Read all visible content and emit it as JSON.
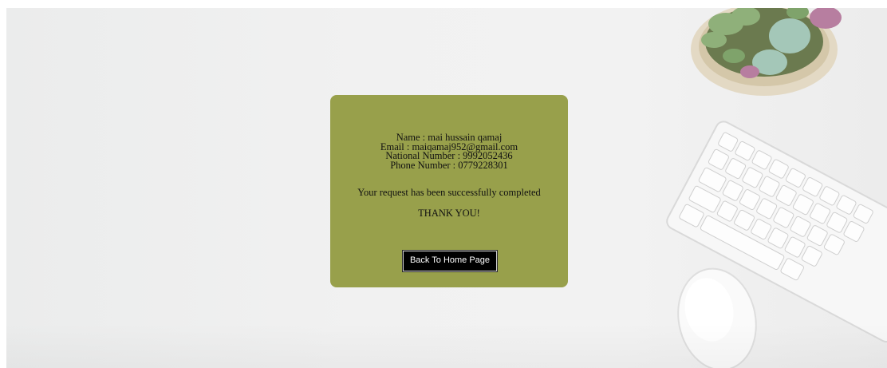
{
  "confirmation": {
    "name_line": "Name : mai hussain qamaj",
    "email_line": "Email : maiqamaj952@gmail.com",
    "national_number_line": "National Number : 9992052436",
    "phone_line": "Phone Number : 0779228301",
    "status_message": "Your request has been successfully completed",
    "thanks_message": "THANK YOU!",
    "back_button_label": "Back To Home Page"
  },
  "colors": {
    "card_background": "#98a04b",
    "button_background": "#000000",
    "button_text": "#ffffff"
  }
}
